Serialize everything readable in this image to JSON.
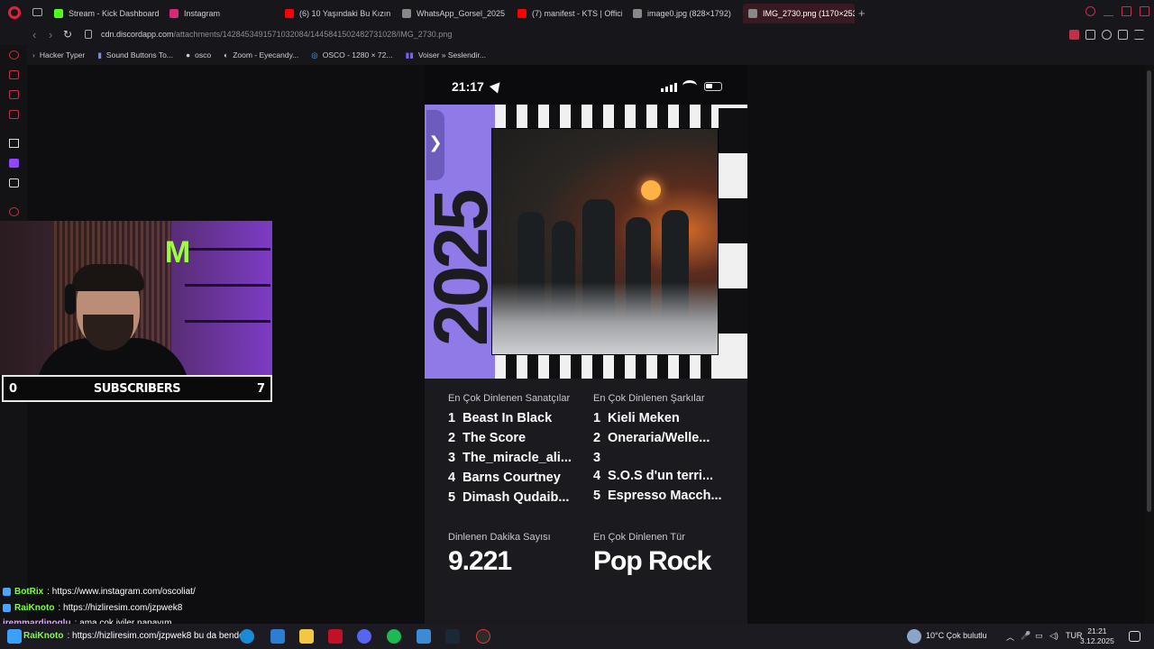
{
  "browser": {
    "tabs": [
      {
        "label": "Stream - Kick Dashboard",
        "color": "#53fc18"
      },
      {
        "label": "Instagram",
        "color": "#d62976"
      },
      {
        "label": "(6) 10 Yaşındaki Bu Kızın",
        "color": "#ff0000"
      },
      {
        "label": "WhatsApp_Gorsel_2025",
        "color": "#888888"
      },
      {
        "label": "(7) manifest - KTS | Offici",
        "color": "#ff0000"
      },
      {
        "label": "image0.jpg (828×1792)",
        "color": "#888888"
      },
      {
        "label": "IMG_2730.png (1170×253",
        "color": "#888888"
      }
    ],
    "url_host": "cdn.discordapp.com",
    "url_path": "/attachments/1428453491571032084/1445841502482731028/IMG_2730.png",
    "bookmarks": [
      {
        "label": "Hacker Typer",
        "icon": "chevron-icon"
      },
      {
        "label": "Sound Buttons To...",
        "icon": "sound-icon"
      },
      {
        "label": "osco",
        "icon": "dot-icon"
      },
      {
        "label": "Zoom - Eyecandy...",
        "icon": "zoom-icon"
      },
      {
        "label": "OSCO - 1280 × 72...",
        "icon": "osco-icon"
      },
      {
        "label": "Voiser » Seslendir...",
        "icon": "voiser-icon"
      }
    ]
  },
  "phone": {
    "time": "21:17",
    "chevron": "❯",
    "col1_heading": "En Çok Dinlenen Sanatçılar",
    "col2_heading": "En Çok Dinlenen Şarkılar",
    "artists": [
      {
        "n": "1",
        "name": "Beast In Black"
      },
      {
        "n": "2",
        "name": "The Score"
      },
      {
        "n": "3",
        "name": "The_miracle_ali..."
      },
      {
        "n": "4",
        "name": "Barns Courtney"
      },
      {
        "n": "5",
        "name": "Dimash Qudaib..."
      }
    ],
    "songs": [
      {
        "n": "1",
        "name": "Kieli Meken"
      },
      {
        "n": "2",
        "name": "Oneraria/Welle..."
      },
      {
        "n": "3",
        "name": ""
      },
      {
        "n": "4",
        "name": "S.O.S d'un terri..."
      },
      {
        "n": "5",
        "name": "Espresso Macch..."
      }
    ],
    "minutes_label": "Dinlenen Dakika Sayısı",
    "minutes_value": "9.221",
    "genre_label": "En Çok Dinlenen Tür",
    "genre_value": "Pop Rock",
    "year_art": "2025",
    "accent": "#8f7ae8"
  },
  "webcam": {
    "subs_left": "0",
    "subs_label": "SUBSCRIBERS",
    "subs_right": "7"
  },
  "chat": [
    {
      "user": "BotRix",
      "text": ": https://www.instagram.com/oscoliat/"
    },
    {
      "user": "RaiKnoto",
      "text": ": https://hizliresim.com/jzpwek8"
    },
    {
      "user": "iremmardinoglu",
      "text": ": ama cok iyiler napayım"
    },
    {
      "user": "RaiKnoto",
      "text": ": https://hizliresim.com/jzpwek8 bu da benden"
    }
  ],
  "taskbar": {
    "weather": "10°C  Çok bulutlu",
    "lang": "TUR",
    "time": "21:21",
    "date": "3.12.2025"
  }
}
